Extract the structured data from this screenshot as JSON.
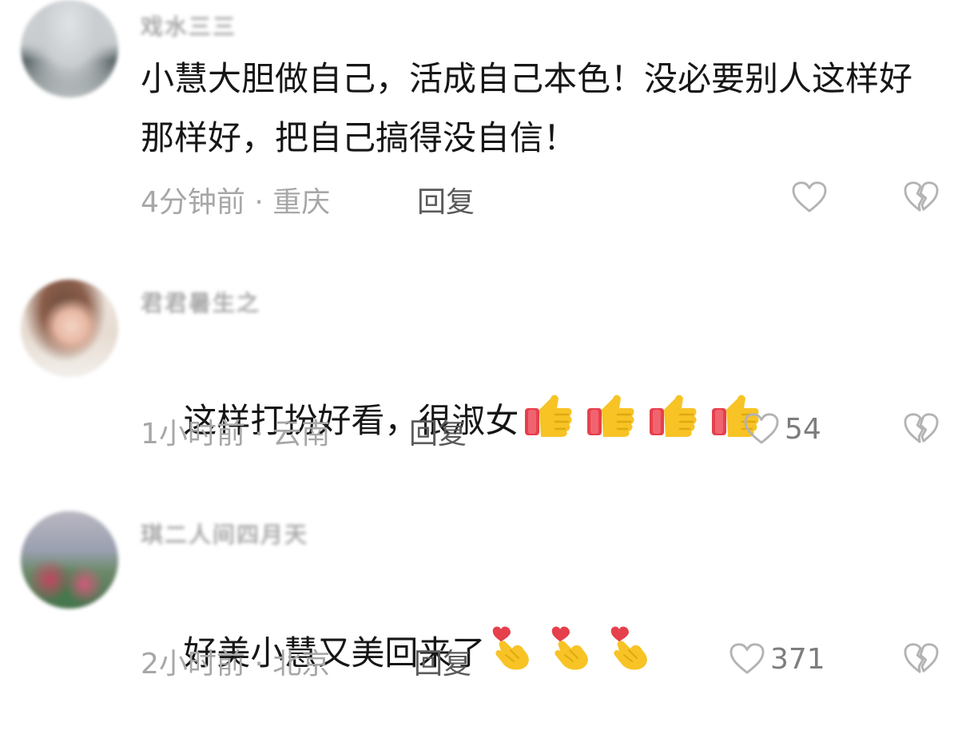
{
  "comments": [
    {
      "username": "戏水三三",
      "text": "小慧大胆做自己，活成自己本色！没必要别人这样好那样好，把自己搞得没自信！",
      "meta": "4分钟前 · 重庆",
      "reply_label": "回复",
      "like_count": ""
    },
    {
      "username": "君君暑生之",
      "text": "这样打扮好看，很淑女",
      "emojis": [
        "thumbs-up",
        "thumbs-up",
        "thumbs-up",
        "thumbs-up"
      ],
      "meta": "1小时前 · 云南",
      "reply_label": "回复",
      "like_count": "54"
    },
    {
      "username": "琪二人间四月天",
      "text": "好美小慧又美回来了",
      "emojis": [
        "finger-heart",
        "finger-heart",
        "finger-heart"
      ],
      "meta": "2小时前 · 北京",
      "reply_label": "回复",
      "like_count": "371"
    }
  ],
  "colors": {
    "meta_gray": "#a7a7a7",
    "reply_gray": "#5a5a5a",
    "emoji_yellow": "#f7c325",
    "emoji_red": "#e5404c"
  }
}
